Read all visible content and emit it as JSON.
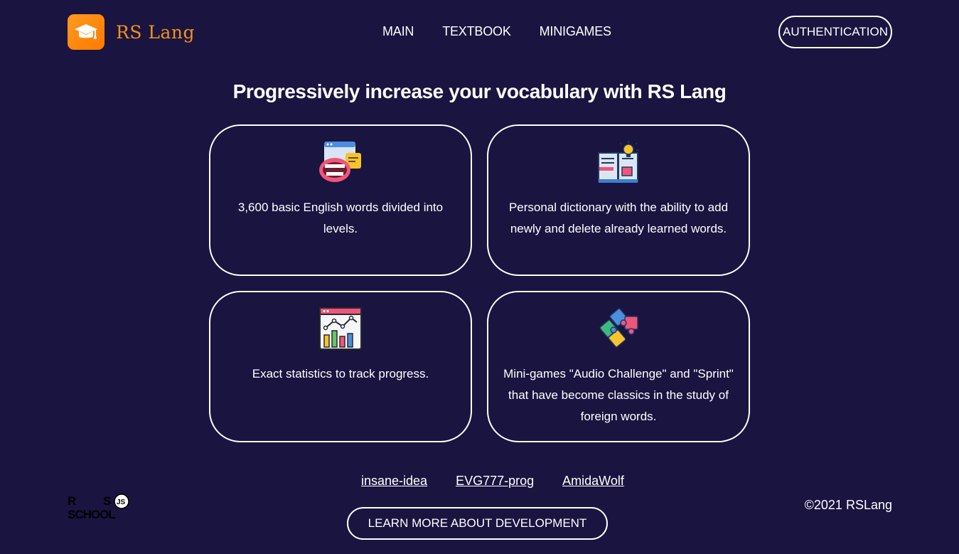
{
  "header": {
    "logo_text": "RS Lang",
    "nav": [
      "MAIN",
      "TEXTBOOK",
      "MINIGAMES"
    ],
    "auth_label": "AUTHENTICATION"
  },
  "main": {
    "headline": "Progressively increase your vocabulary with RS Lang",
    "cards": [
      {
        "icon": "speaking-mouth-icon",
        "text": "3,600 basic English words divided into levels."
      },
      {
        "icon": "book-lightbulb-icon",
        "text": "Personal dictionary with the ability to add newly and delete already learned words."
      },
      {
        "icon": "statistics-chart-icon",
        "text": "Exact statistics to track progress."
      },
      {
        "icon": "puzzle-icon",
        "text": "Mini-games \"Audio Challenge\" and \"Sprint\" that have become classics in the study of foreign words."
      }
    ]
  },
  "footer": {
    "dev_links": [
      "insane-idea",
      "EVG777-prog",
      "AmidaWolf"
    ],
    "learn_more_label": "LEARN MORE ABOUT DEVELOPMENT",
    "copyright": "©2021 RSLang",
    "school_logo_text": "RS SCHOOL JS"
  },
  "colors": {
    "background": "#1a1440",
    "logo_orange": "#f0921e",
    "foreground": "#ffffff"
  }
}
